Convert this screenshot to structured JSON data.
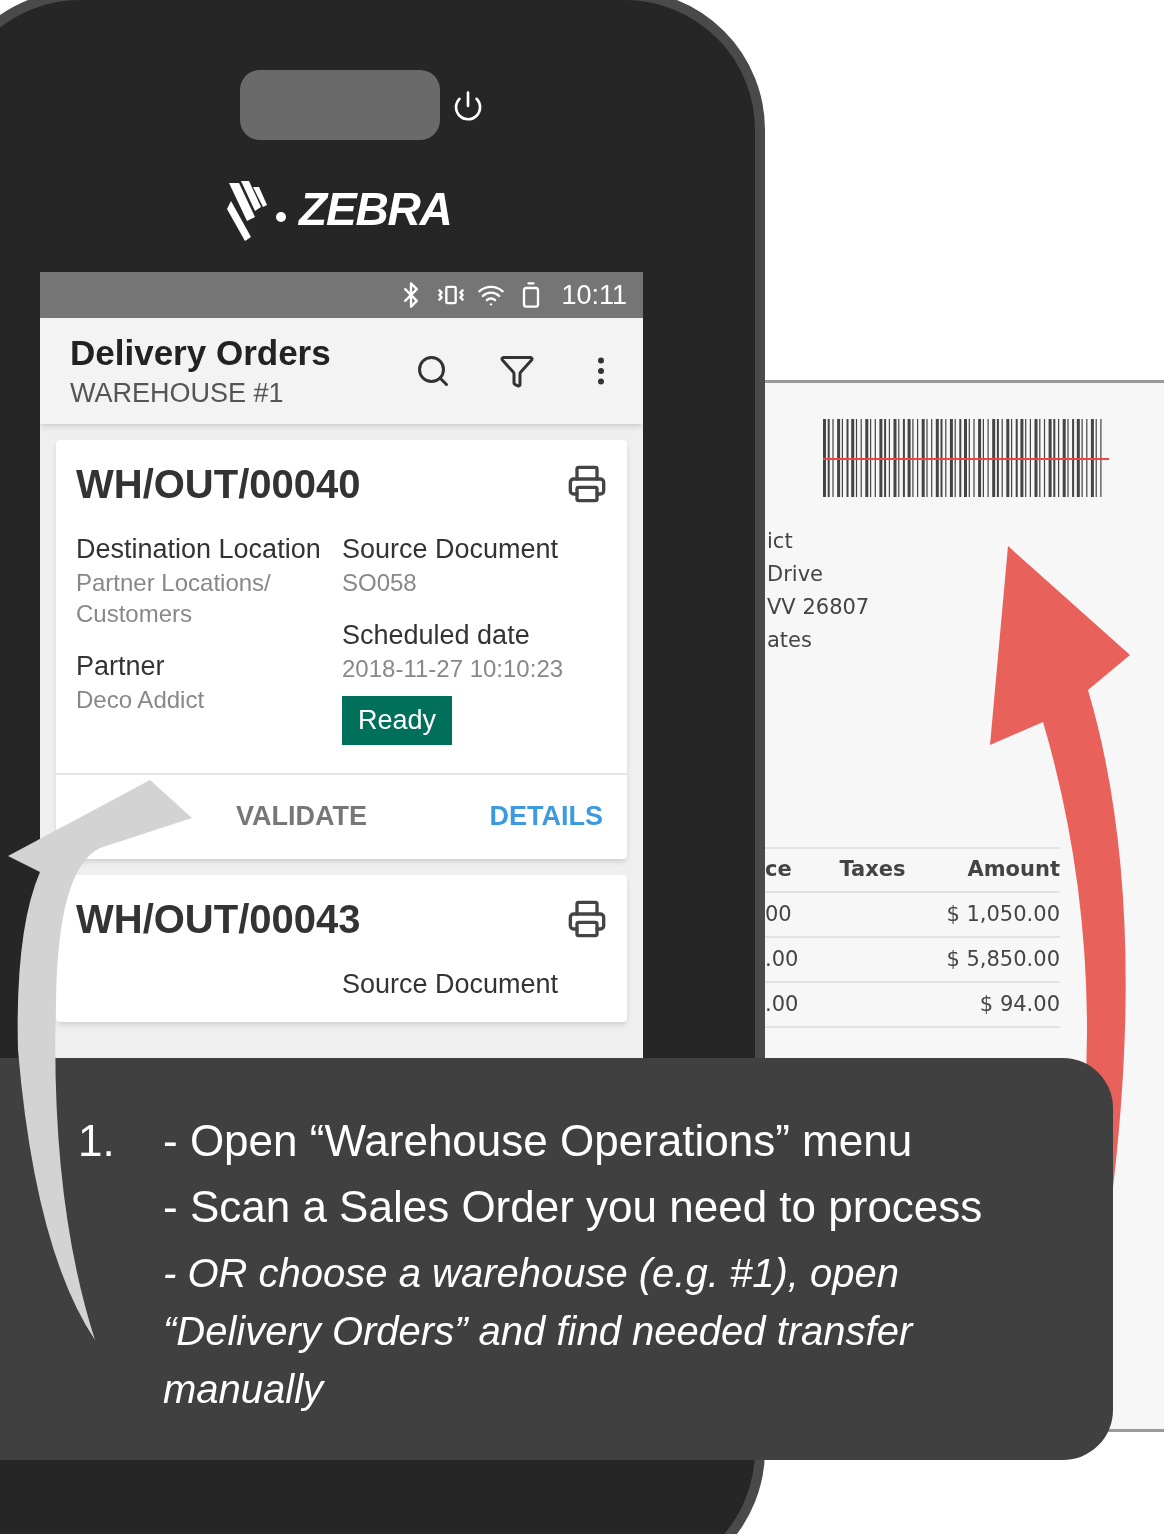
{
  "device": {
    "brand": "ZEBRA"
  },
  "status_bar": {
    "time": "10:11"
  },
  "app_bar": {
    "title": "Delivery Orders",
    "subtitle": "WAREHOUSE #1"
  },
  "orders": [
    {
      "number": "WH/OUT/00040",
      "left_fields": [
        {
          "label": "Destination Location",
          "value": "Partner Locations/ Customers"
        },
        {
          "label": "Partner",
          "value": "Deco Addict"
        }
      ],
      "right_fields": [
        {
          "label": "Source Document",
          "value": "SO058"
        },
        {
          "label": "Scheduled date",
          "value": "2018-11-27 10:10:23"
        }
      ],
      "status": "Ready",
      "actions": [
        {
          "label": "VALIDATE",
          "kind": "plain"
        },
        {
          "label": "DETAILS",
          "kind": "primary"
        }
      ]
    },
    {
      "number": "WH/OUT/00043",
      "right_fields": [
        {
          "label": "Source Document"
        }
      ]
    }
  ],
  "document": {
    "address_lines": [
      "ict",
      "Drive",
      "VV 26807",
      "ates"
    ],
    "table": {
      "columns": [
        "ce",
        "Taxes",
        "Amount"
      ],
      "rows": [
        [
          "00",
          "",
          "$ 1,050.00"
        ],
        [
          ".00",
          "",
          "$ 5,850.00"
        ],
        [
          ".00",
          "",
          "$ 94.00"
        ]
      ]
    }
  },
  "instruction": {
    "number": "1.",
    "steps": [
      {
        "kind": "main",
        "text": "- Open “Warehouse Operations” menu"
      },
      {
        "kind": "main",
        "text": "- Scan a Sales Order you need to process"
      },
      {
        "kind": "note",
        "text": "- OR choose a warehouse (e.g. #1), open “Delivery Orders” and find needed transfer manually"
      }
    ]
  }
}
